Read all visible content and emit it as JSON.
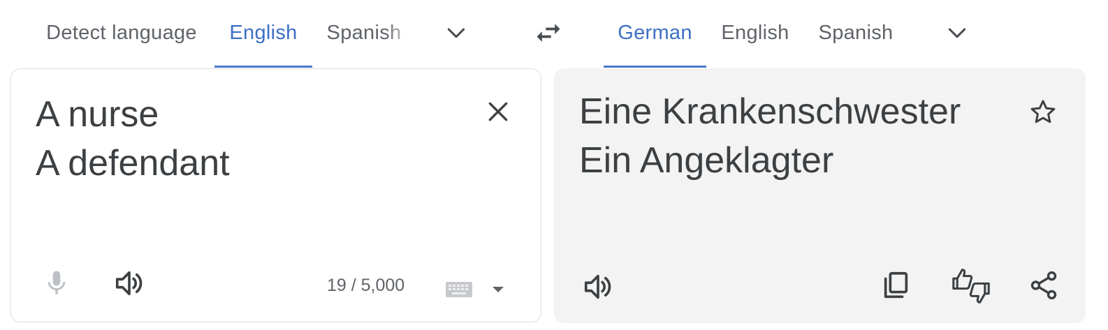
{
  "source_languages": {
    "tabs": [
      "Detect language",
      "English",
      "Spanish"
    ],
    "active": "English"
  },
  "target_languages": {
    "tabs": [
      "German",
      "English",
      "Spanish"
    ],
    "active": "German"
  },
  "source": {
    "lines": [
      "A nurse",
      "A defendant"
    ],
    "char_count": "19 / 5,000"
  },
  "target": {
    "lines": [
      "Eine Krankenschwester",
      "Ein Angeklagter"
    ]
  },
  "colors": {
    "accent": "#3d6fc4",
    "tab_text": "#5f6368",
    "body_text": "#3c4043",
    "target_panel_bg": "#f3f3f3"
  },
  "icons": [
    "chevron-down-icon",
    "swap-icon",
    "close-icon",
    "microphone-icon",
    "speaker-icon",
    "keyboard-icon",
    "caret-down-icon",
    "star-icon",
    "copy-icon",
    "feedback-icon",
    "share-icon"
  ]
}
